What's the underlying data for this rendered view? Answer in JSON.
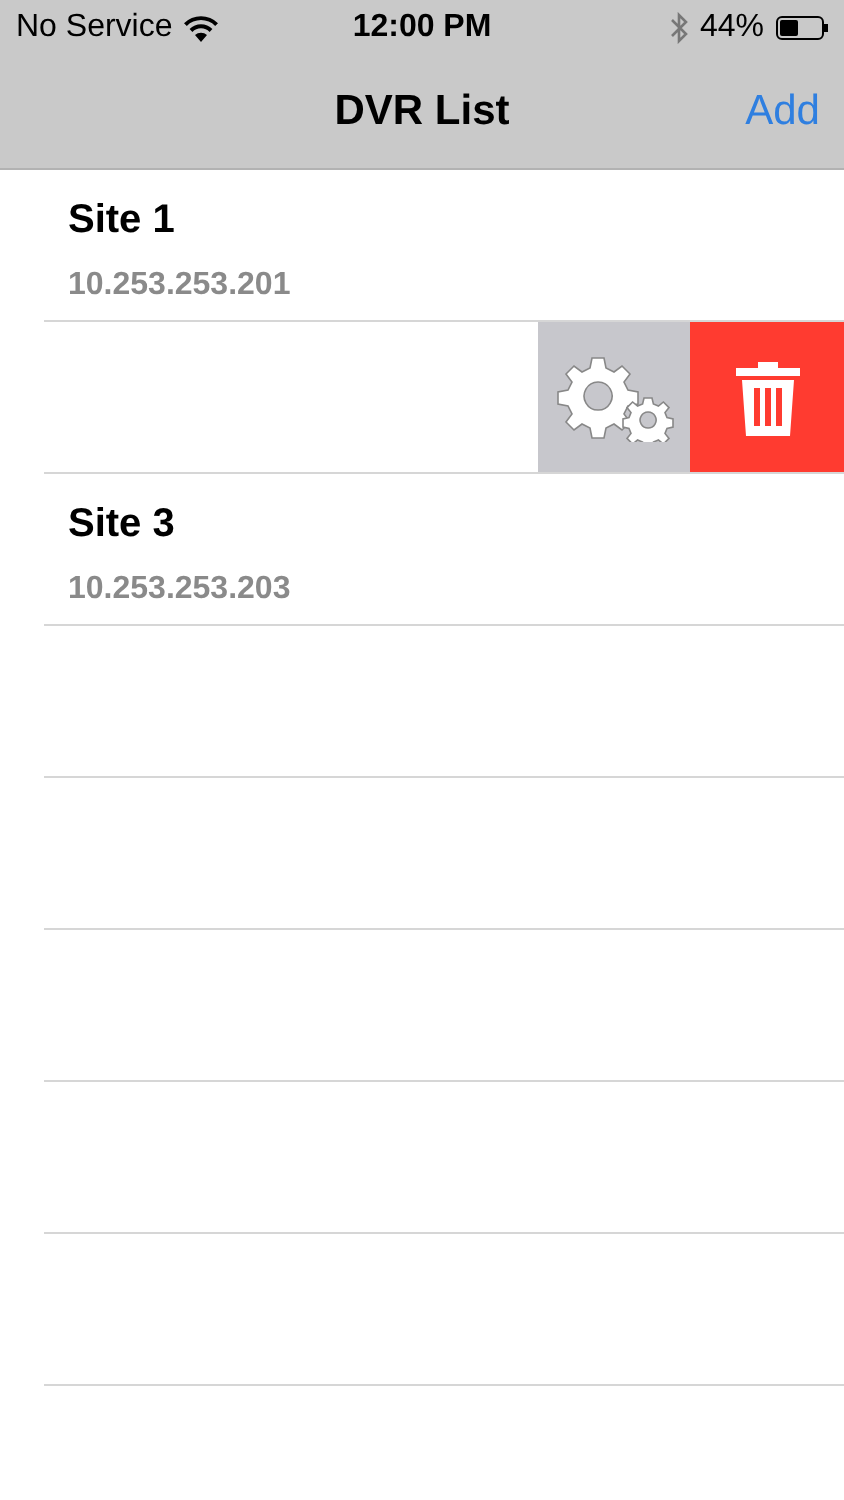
{
  "status_bar": {
    "carrier": "No Service",
    "time": "12:00 PM",
    "battery": "44%"
  },
  "nav_bar": {
    "title": "DVR List",
    "action": "Add"
  },
  "rows": [
    {
      "title": "Site 1",
      "address": "10.253.253.201",
      "swiped": false
    },
    {
      "swiped": true
    },
    {
      "title": "Site 3",
      "address": "10.253.253.203",
      "swiped": false
    }
  ]
}
